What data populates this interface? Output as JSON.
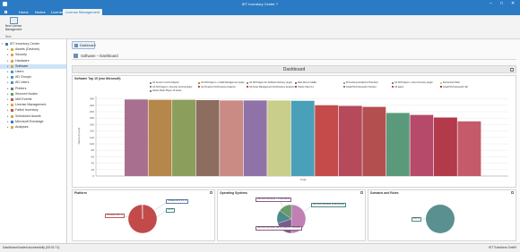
{
  "window": {
    "title": "IET Inventory Center 7",
    "controls": [
      "–",
      "□",
      "✕"
    ]
  },
  "menu": {
    "tabs": [
      {
        "label": "",
        "active": false
      },
      {
        "label": "Home",
        "active": false
      },
      {
        "label": "Nodes",
        "active": false
      },
      {
        "label": "Licenses",
        "active": false
      },
      {
        "label": "License Management",
        "active": true
      }
    ]
  },
  "ribbon": {
    "new_button_label": "New License Management",
    "group_label": "New"
  },
  "tree": {
    "items": [
      {
        "label": "IET Inventory Center",
        "level": 0,
        "expanded": true,
        "selected": false,
        "color": "#2b7bc4"
      },
      {
        "label": "Assets (Devices)",
        "level": 1,
        "expanded": false,
        "selected": false,
        "color": "#d9a441"
      },
      {
        "label": "Security",
        "level": 1,
        "expanded": false,
        "selected": false,
        "color": "#d9a441"
      },
      {
        "label": "Hardware",
        "level": 1,
        "expanded": false,
        "selected": false,
        "color": "#d9a441"
      },
      {
        "label": "Software",
        "level": 1,
        "expanded": false,
        "selected": true,
        "color": "#d9a441"
      },
      {
        "label": "Users",
        "level": 1,
        "expanded": false,
        "selected": false,
        "color": "#4a90c8"
      },
      {
        "label": "AD Groups",
        "level": 1,
        "expanded": false,
        "selected": false,
        "color": "#4a90c8"
      },
      {
        "label": "AD Users",
        "level": 1,
        "expanded": false,
        "selected": false,
        "color": "#4a90c8"
      },
      {
        "label": "Printers",
        "level": 1,
        "expanded": false,
        "selected": false,
        "color": "#777777"
      },
      {
        "label": "Secured Nodes",
        "level": 1,
        "expanded": false,
        "selected": false,
        "color": "#5a9e5a"
      },
      {
        "label": "IAM Events",
        "level": 1,
        "expanded": false,
        "selected": false,
        "color": "#c0504d"
      },
      {
        "label": "License Management",
        "level": 1,
        "expanded": false,
        "selected": false,
        "color": "#d9a441"
      },
      {
        "label": "Failed Inventory",
        "level": 1,
        "expanded": false,
        "selected": false,
        "color": "#c0504d"
      },
      {
        "label": "Scheduled Assets",
        "level": 1,
        "expanded": false,
        "selected": false,
        "color": "#d9a441"
      },
      {
        "label": "Microsoft Exchange",
        "level": 1,
        "expanded": false,
        "selected": false,
        "color": "#2b7bc4"
      },
      {
        "label": "Analyses",
        "level": 1,
        "expanded": false,
        "selected": false,
        "color": "#d9a441"
      }
    ]
  },
  "main": {
    "tab_label": "Dashboard",
    "breadcrumb": "Software – Dashboard",
    "dashboard_title": "Dashboard"
  },
  "panels": {
    "software_title": "Software Top 15 (non Microsoft)",
    "platform_title": "Platform",
    "os_title": "Operating Systems",
    "domains_title": "Domains and Roles"
  },
  "chart_data": [
    {
      "type": "bar",
      "title": "Software Top 15 (non Microsoft)",
      "xlabel": "Total",
      "ylabel": "Name (Count)",
      "ylim": [
        0,
        250
      ],
      "yticks": [
        0,
        20,
        40,
        60,
        80,
        100,
        120,
        140,
        160,
        180,
        200,
        220,
        240
      ],
      "grid": true,
      "legend_position": "top",
      "categories": [
        "Total"
      ],
      "series": [
        {
          "name": "Git Source Control Adapter",
          "value": 238,
          "color": "#a86f8f"
        },
        {
          "name": "Git SCM Agent + Install Management plugin",
          "value": 237,
          "color": "#b5874a"
        },
        {
          "name": "Git SCM Agent for Software Delivery plugin",
          "value": 237,
          "color": "#8b9e5b"
        },
        {
          "name": "Data Runs Installer",
          "value": 236,
          "color": "#8c6d5f"
        },
        {
          "name": "Prometheus Endpoint Protection",
          "value": 235,
          "color": "#c98b83"
        },
        {
          "name": "Git SCM Agent + Alert Inventory plugin",
          "value": 235,
          "color": "#8f73a8"
        },
        {
          "name": "Dockerized Shell",
          "value": 235,
          "color": "#c9cf8a"
        },
        {
          "name": "Git SCM Agent + Remote Control plugin",
          "value": 234,
          "color": "#4aa0b8"
        },
        {
          "name": "Git Dynamic Performance Analyzer",
          "value": 220,
          "color": "#c54a4a"
        },
        {
          "name": "Git Asset Management Performance Analyzer",
          "value": 218,
          "color": "#b54a5a"
        },
        {
          "name": "Oracle Client 11",
          "value": 215,
          "color": "#b44f4f"
        },
        {
          "name": "Java(TM) Framework Checker",
          "value": 196,
          "color": "#5a9a7a"
        },
        {
          "name": "Git agent",
          "value": 190,
          "color": "#b54a6a"
        },
        {
          "name": "Java(TM) Framework SE",
          "value": 182,
          "color": "#b23a4a"
        },
        {
          "name": "Adobe Flash Player 10 Active",
          "value": 170,
          "color": "#c45a6a"
        }
      ]
    },
    {
      "type": "pie",
      "title": "Platform",
      "series": [
        {
          "name": "Windows",
          "value": 99.5,
          "label": "Windows 99.5 %",
          "color": "#c34a4a"
        },
        {
          "name": "VMware ESX",
          "value": 0.3,
          "label": "VMware ESX 0.3 %",
          "color": "#5a7fb0"
        },
        {
          "name": "Other",
          "value": 0.2,
          "label": "0.2 %",
          "color": "#5a9e5a"
        }
      ]
    },
    {
      "type": "pie",
      "title": "Operating Systems",
      "series": [
        {
          "name": "Microsoft Windows 7 Professional",
          "value": 50,
          "color": "#c080b5"
        },
        {
          "name": "Microsoft Windows Server 2008 R2 Standard",
          "value": 20,
          "color": "#7a5a90"
        },
        {
          "name": "Microsoft Windows 10 Enterprise",
          "value": 15,
          "color": "#4a8a8a"
        },
        {
          "name": "Other",
          "value": 15,
          "color": "#6a9a6a"
        }
      ]
    },
    {
      "type": "pie",
      "title": "Domains and Roles",
      "series": [
        {
          "name": "",
          "value": 100,
          "label": "100 %",
          "color": "#5a9090"
        }
      ]
    }
  ],
  "status": {
    "left": "Dashboard loaded successfully (00:01:71)",
    "right": "IET Solutions GmbH"
  }
}
